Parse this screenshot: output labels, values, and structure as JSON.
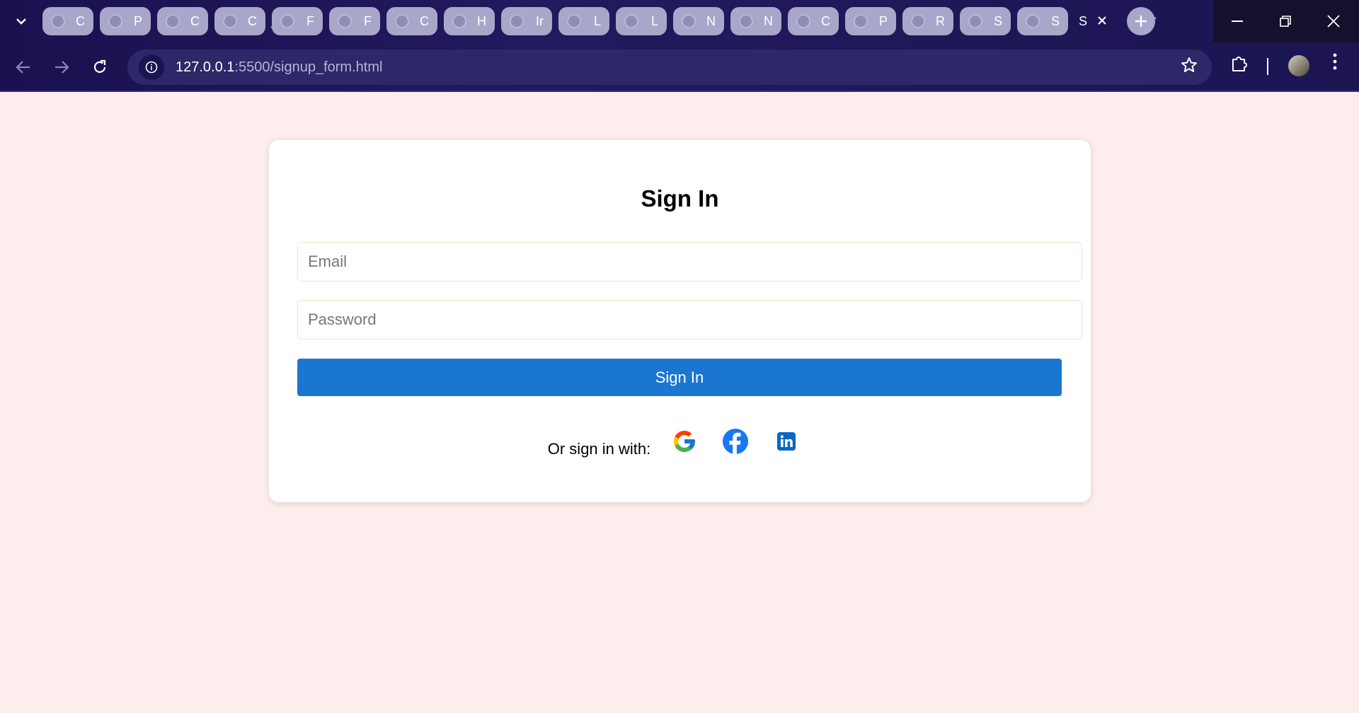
{
  "browser": {
    "tabs": [
      {
        "letter": "C"
      },
      {
        "letter": "P"
      },
      {
        "letter": "C"
      },
      {
        "letter": "C"
      },
      {
        "letter": "F"
      },
      {
        "letter": "F"
      },
      {
        "letter": "C"
      },
      {
        "letter": "H"
      },
      {
        "letter": "Ir"
      },
      {
        "letter": "L"
      },
      {
        "letter": "L"
      },
      {
        "letter": "N"
      },
      {
        "letter": "N"
      },
      {
        "letter": "C"
      },
      {
        "letter": "P"
      },
      {
        "letter": "R"
      },
      {
        "letter": "S"
      },
      {
        "letter": "S"
      }
    ],
    "active_tab": {
      "letter": "S"
    },
    "url_host": "127.0.0.1",
    "url_rest": ":5500/signup_form.html",
    "icons": {
      "tab_search": "chevron-down-icon",
      "new_tab": "plus-icon",
      "back": "arrow-left-icon",
      "forward": "arrow-right-icon",
      "reload": "reload-icon",
      "site_info": "info-icon",
      "bookmark": "star-icon",
      "extensions": "puzzle-icon",
      "menu": "kebab-menu-icon"
    }
  },
  "form": {
    "title": "Sign In",
    "email_placeholder": "Email",
    "password_placeholder": "Password",
    "submit_label": "Sign In",
    "social_label": "Or sign in with:",
    "social_providers": [
      "Google",
      "Facebook",
      "LinkedIn"
    ]
  },
  "colors": {
    "page_background": "#fdeded",
    "primary_button": "#1b76d2",
    "facebook": "#1877f2",
    "linkedin": "#0a66c2"
  }
}
